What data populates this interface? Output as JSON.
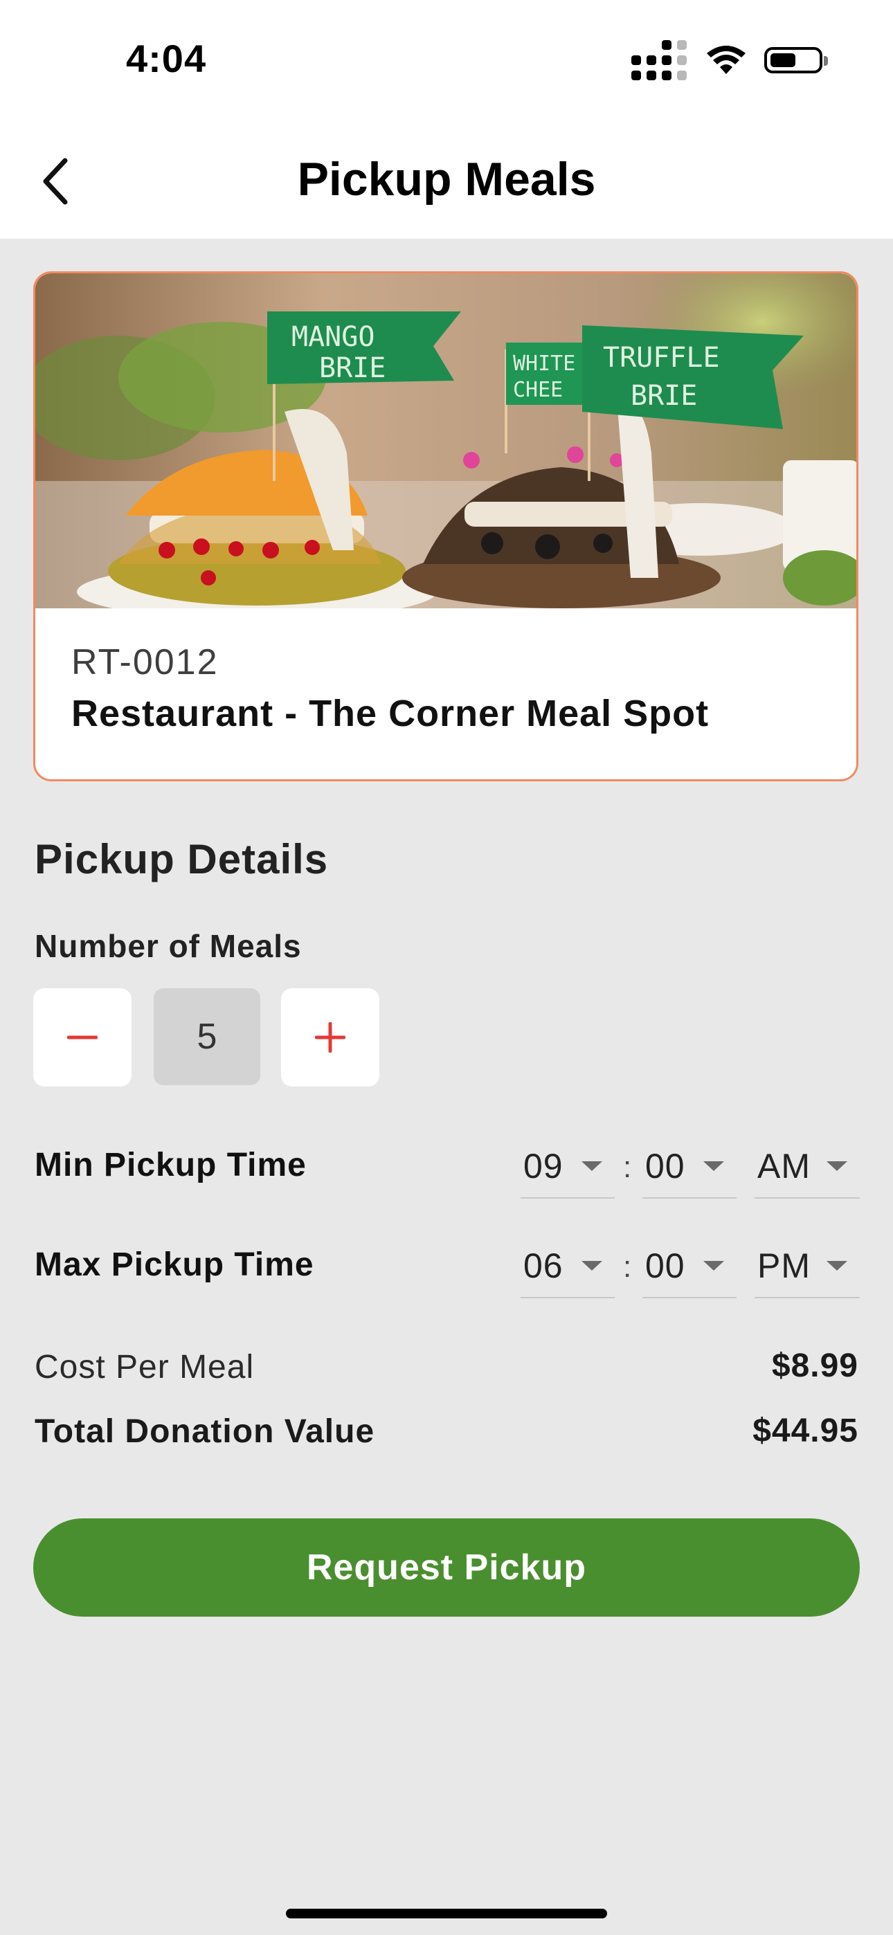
{
  "status_bar": {
    "time": "4:04",
    "icons": [
      "cellular-signal-icon",
      "wifi-icon",
      "battery-icon"
    ]
  },
  "header": {
    "title": "Pickup Meals",
    "back_icon": "chevron-left-icon"
  },
  "restaurant": {
    "photo": {
      "flags": [
        "MANGO\nBRIE",
        "WHITE\nCHEE",
        "TRUFFLE\nBRIE"
      ]
    },
    "id": "RT-0012",
    "name": "Restaurant - The Corner Meal Spot"
  },
  "pickup_details": {
    "title": "Pickup Details",
    "meals_label": "Number of Meals",
    "meals_count": "5",
    "min_time": {
      "label": "Min Pickup Time",
      "hour": "09",
      "separator": ":",
      "minute": "00",
      "period": "AM"
    },
    "max_time": {
      "label": "Max Pickup Time",
      "hour": "06",
      "separator": ":",
      "minute": "00",
      "period": "PM"
    }
  },
  "summary": {
    "cost_label": "Cost Per Meal",
    "cost_value": "$8.99",
    "total_label": "Total Donation Value",
    "total_value": "$44.95"
  },
  "cta": {
    "label": "Request Pickup"
  },
  "colors": {
    "accent_green": "#4a8f2f",
    "card_border": "#f08a63",
    "stepper_red": "#e53935",
    "background": "#e8e8e8"
  }
}
